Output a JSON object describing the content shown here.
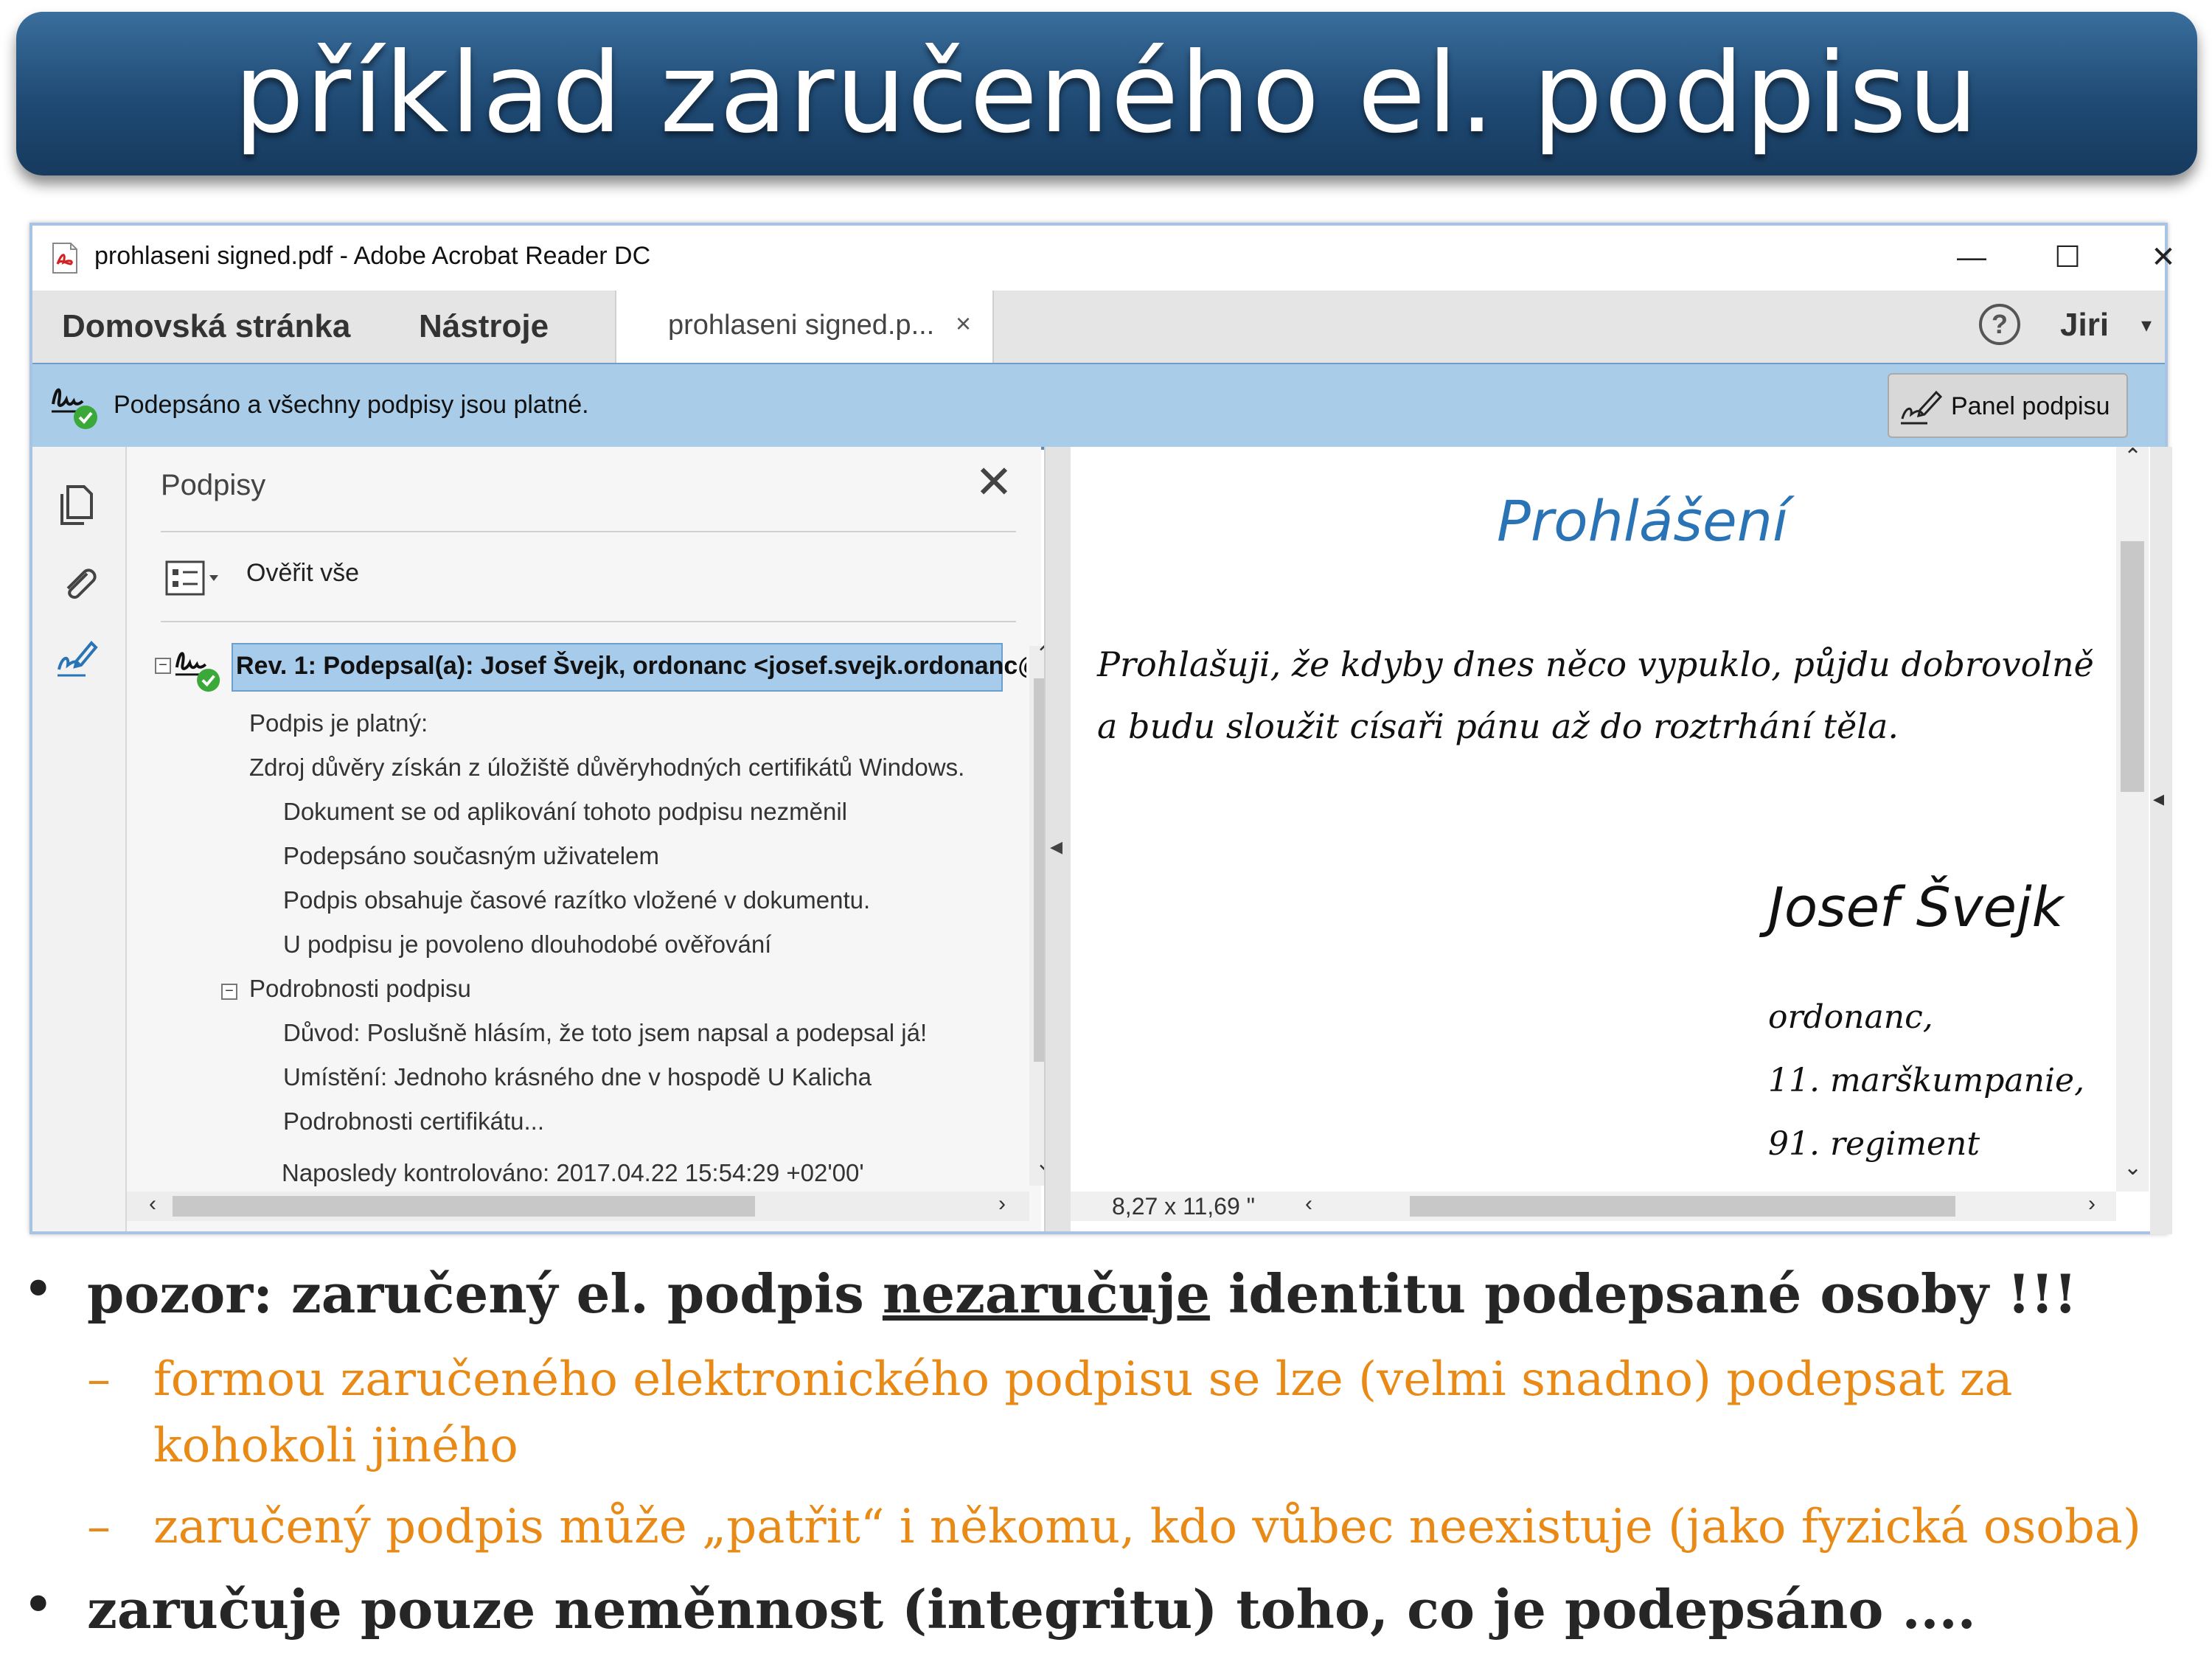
{
  "slide": {
    "title": "příklad zaručeného el. podpisu",
    "bullets": {
      "b1_before": "pozor: zaručený el. podpis ",
      "b1_underlined": "nezaručuje",
      "b1_after": " identitu podepsané osoby !!!",
      "sub1_line1": "formou zaručeného elektronického podpisu se lze (velmi snadno) podepsat za",
      "sub1_line2": "kohokoli jiného",
      "sub2": "zaručený podpis může „patřit“ i někomu, kdo vůbec neexistuje (jako fyzická osoba)",
      "b2": "zaručuje pouze neměnnost (integritu) toho, co je podepsáno ....",
      "bullet_glyph": "•",
      "dash_glyph": "–"
    }
  },
  "window": {
    "title": "prohlaseni signed.pdf - Adobe Acrobat Reader DC",
    "controls": {
      "minimize": "—",
      "maximize": "☐",
      "close": "✕"
    }
  },
  "menubar": {
    "home": "Domovská stránka",
    "tools": "Nástroje",
    "tab_label": "prohlaseni signed.p...",
    "tab_close": "×",
    "help": "?",
    "user": "Jiri",
    "user_caret": "▾"
  },
  "signature_bar": {
    "message": "Podepsáno a všechny podpisy jsou platné.",
    "panel_button": "Panel podpisu"
  },
  "signature_panel": {
    "heading": "Podpisy",
    "close": "✕",
    "verify_all": "Ověřit vše",
    "selected_item": "Rev. 1: Podepsal(a): Josef Švejk, ordonanc <josef.svejk.ordonanc@",
    "tree": [
      "Podpis je platný:",
      "Zdroj důvěry získán z úložiště důvěryhodných certifikátů Windows.",
      "Dokument se od aplikování tohoto podpisu nezměnil",
      "Podepsáno současným uživatelem",
      "Podpis obsahuje časové razítko vložené v dokumentu.",
      "U podpisu je povoleno dlouhodobé ověřování",
      "Podrobnosti podpisu",
      "Důvod: Poslušně hlásím, že toto jsem napsal a podepsal já!",
      "Umístění: Jednoho krásného dne v hospodě U Kalicha",
      "Podrobnosti certifikátu...",
      "Naposledy kontrolováno: 2017.04.22 15:54:29 +02'00'"
    ]
  },
  "document": {
    "heading": "Prohlášení",
    "body_line1": "Prohlašuji, že kdyby dnes něco vypuklo, půjdu dobrovolně",
    "body_line2": "a budu sloužit císaři pánu až do roztrhání těla.",
    "signer_name": "Josef Švejk",
    "signer_line1": "ordonanc,",
    "signer_line2": "11. marškumpanie,",
    "signer_line3": "91. regiment",
    "page_size": "8,27 x 11,69 \""
  },
  "colors": {
    "banner": "#1f4a74",
    "signature_bar": "#a9cde8",
    "selection": "#a7cbea",
    "heading_blue": "#2a73b5",
    "sub_bullet_orange": "#e98a16"
  }
}
